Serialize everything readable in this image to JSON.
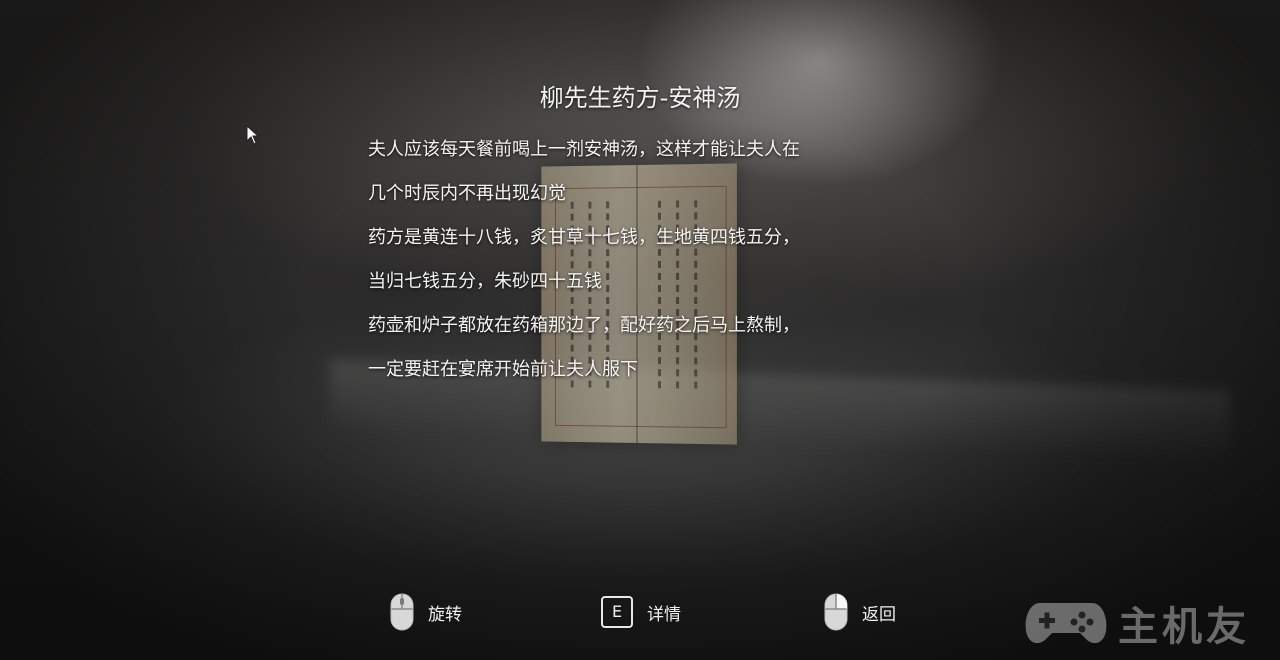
{
  "game_logo_text": "",
  "item": {
    "title": "柳先生药方-安神汤",
    "description_lines": [
      "夫人应该每天餐前喝上一剂安神汤，这样才能让夫人在",
      "几个时辰内不再出现幻觉",
      "药方是黄连十八钱，炙甘草十七钱，生地黄四钱五分，",
      "当归七钱五分，朱砂四十五钱",
      "药壶和炉子都放在药箱那边了，配好药之后马上熬制，",
      "一定要赶在宴席开始前让夫人服下"
    ]
  },
  "controls": [
    {
      "icon": "mouse-left-click-icon",
      "label": "旋转"
    },
    {
      "icon": "e-key-icon",
      "key": "E",
      "label": "详情"
    },
    {
      "icon": "mouse-right-click-icon",
      "label": "返回"
    }
  ],
  "watermark": {
    "icon": "gamepad-icon",
    "text": "主机友"
  },
  "colors": {
    "text": "#f4f4f4",
    "background": "#2a2929"
  }
}
